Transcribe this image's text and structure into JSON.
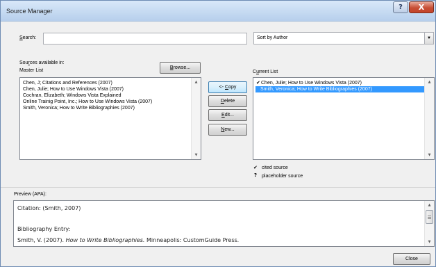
{
  "window": {
    "title": "Source Manager",
    "help_glyph": "?",
    "close_glyph": "X"
  },
  "search": {
    "label_key": "S",
    "label_rest": "earch:",
    "value": "",
    "placeholder": ""
  },
  "sort": {
    "selected": "Sort by Author",
    "dropdown_glyph": "▼"
  },
  "sources_available": {
    "line1_pre": "Sou",
    "line1_key": "r",
    "line1_post": "ces available in:",
    "line2": "Master List"
  },
  "browse_button": {
    "key": "B",
    "rest": "rowse..."
  },
  "current_list": {
    "pre": "C",
    "key": "u",
    "post": "rrent List"
  },
  "master_list": {
    "items": [
      "Chen, J; Citations and References (2007)",
      "Chen, Julie; How to Use Windows Vista (2007)",
      "Cochran, Elizabeth; Windows Vista Explained",
      "Online Trainig Point, Inc.; How to Use Windows Vista (2007)",
      "Smith, Veronica; How to Write Bibliographies (2007)"
    ]
  },
  "current_items": [
    {
      "mark": "✔",
      "label": "Chen, Julie; How to Use Windows Vista (2007)",
      "selected": false
    },
    {
      "mark": "",
      "label": "Smith, Veronica; How to Write Bibliographies (2007)",
      "selected": true
    }
  ],
  "actions": {
    "copy": {
      "pre": "<- ",
      "key": "C",
      "post": "opy"
    },
    "delete": {
      "key": "D",
      "post": "elete"
    },
    "edit": {
      "key": "E",
      "post": "dit..."
    },
    "new": {
      "key": "N",
      "post": "ew..."
    }
  },
  "legend": {
    "cited": {
      "mark": "✔",
      "label": "cited source"
    },
    "placeholder": {
      "mark": "?",
      "label": "placeholder source"
    }
  },
  "preview": {
    "label": "Preview (APA):",
    "citation": "Citation:  (Smith, 2007)",
    "bib_heading": "Bibliography Entry:",
    "bib_pre": "Smith, V. (2007). ",
    "bib_title": "How to Write Bibliographies.",
    "bib_post": " Minneapolis: CustomGuide Press."
  },
  "close_button": {
    "label": "Close"
  },
  "scroll": {
    "up": "▲",
    "down": "▼"
  }
}
